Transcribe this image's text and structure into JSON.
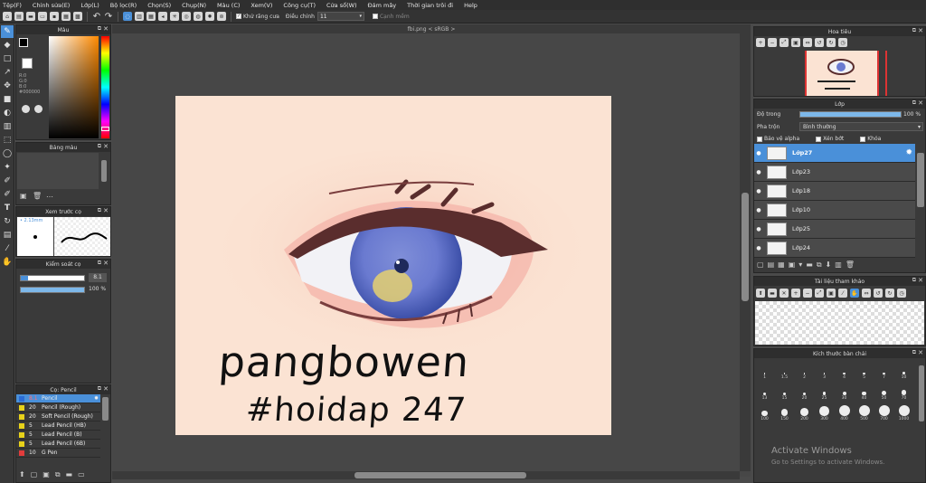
{
  "menu": [
    "Tệp(F)",
    "Chỉnh sửa(E)",
    "Lớp(L)",
    "Bộ lọc(R)",
    "Chọn(S)",
    "Chụp(N)",
    "Màu (C)",
    "Xem(V)",
    "Công cụ(T)",
    "Cửa sổ(W)",
    "Đám mây",
    "Thời gian trôi đi",
    "Help"
  ],
  "toolbar": {
    "antialias_label": "Khử răng cưa",
    "adjust_label": "Điều chỉnh",
    "adjust_value": "11",
    "edge_label": "Cạnh mềm",
    "antialias_check": "✓"
  },
  "color_panel": {
    "title": "Màu",
    "hex": "#000000",
    "r": "R:0",
    "g": "G:0",
    "b": "B:0"
  },
  "palette_panel": {
    "title": "Bảng màu"
  },
  "brush_preview": {
    "title": "Xem trước cọ",
    "size": "2.13mm"
  },
  "brush_control": {
    "title": "Kiểm soát cọ",
    "size_value": "8.1",
    "opacity_value": "100 %",
    "opacity_fraction": 1.0,
    "size_fraction": 0.12
  },
  "brush_list": {
    "title": "Cọ: Pencil",
    "items": [
      {
        "size": "8.1",
        "name": "Pencil",
        "color": "#2b6cd6",
        "active": true
      },
      {
        "size": "20",
        "name": "Pencil (Rough)",
        "color": "#e8d21a"
      },
      {
        "size": "20",
        "name": "Soft Pencil (Rough)",
        "color": "#e8d21a"
      },
      {
        "size": "5",
        "name": "Lead Pencil (HB)",
        "color": "#e8d21a"
      },
      {
        "size": "5",
        "name": "Lead Pencil (B)",
        "color": "#e8d21a"
      },
      {
        "size": "5",
        "name": "Lead Pencil (6B)",
        "color": "#e8d21a"
      },
      {
        "size": "10",
        "name": "G Pen",
        "color": "#e23c3c"
      }
    ]
  },
  "document": {
    "tab": "fbi.png < sRGB >"
  },
  "artwork": {
    "line1": "pangbowen",
    "line2": "#hoidap 247"
  },
  "navigator": {
    "title": "Hoa tiêu"
  },
  "layer_panel": {
    "title": "Lớp",
    "opacity_label": "Độ trong",
    "opacity_value": "100 %",
    "blend_label": "Pha trộn",
    "blend_value": "Bình thường",
    "protect_alpha": "Bảo vệ alpha",
    "clipping": "Xén bớt",
    "lock": "Khóa",
    "layers": [
      {
        "name": "Lớp27",
        "active": true
      },
      {
        "name": "Lớp23"
      },
      {
        "name": "Lớp18"
      },
      {
        "name": "Lớp10"
      },
      {
        "name": "Lớp25"
      },
      {
        "name": "Lớp24"
      }
    ]
  },
  "reference_panel": {
    "title": "Tài liệu tham khảo"
  },
  "brush_size_panel": {
    "title": "Kích thước bàn chải",
    "sizes": [
      "1",
      "1.5",
      "2",
      "3",
      "4",
      "5",
      "7",
      "10",
      "13",
      "15",
      "20",
      "25",
      "30",
      "40",
      "50",
      "70",
      "100",
      "150",
      "200",
      "300",
      "400",
      "500",
      "700",
      "1000"
    ]
  },
  "watermark": {
    "line1": "Activate Windows",
    "line2": "Go to Settings to activate Windows."
  }
}
